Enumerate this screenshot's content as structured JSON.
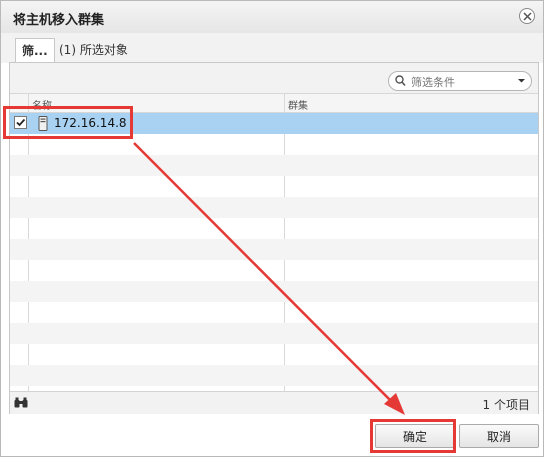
{
  "dialog": {
    "title": "将主机移入群集",
    "tabs": [
      {
        "label": "筛..."
      },
      {
        "label": "(1) 所选对象"
      }
    ],
    "filter": {
      "placeholder": "筛选条件"
    },
    "table": {
      "columns": [
        "名称",
        "群集"
      ],
      "rows": [
        {
          "checked": true,
          "icon": "host-icon",
          "name": "172.16.14.8",
          "cluster": ""
        }
      ]
    },
    "item_count": "1 个项目",
    "buttons": {
      "ok": "确定",
      "cancel": "取消"
    }
  },
  "annotations": {
    "color": "#e53935"
  }
}
